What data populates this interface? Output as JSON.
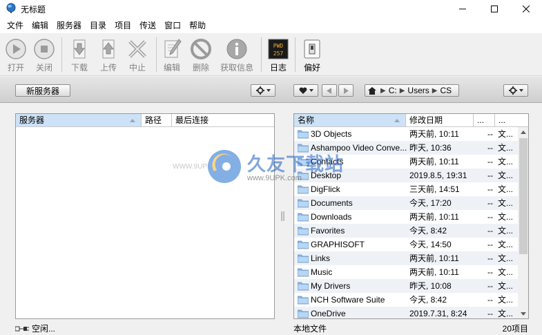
{
  "window": {
    "title": "无标题"
  },
  "menu": [
    "文件",
    "编辑",
    "服务器",
    "目录",
    "项目",
    "传送",
    "窗口",
    "帮助"
  ],
  "toolbar": {
    "open": "打开",
    "close": "关闭",
    "download": "下载",
    "upload": "上传",
    "abort": "中止",
    "edit": "编辑",
    "delete": "删除",
    "get_info": "获取信息",
    "log": "日志",
    "log_icon_text": "PWD\n257",
    "prefs": "偏好"
  },
  "subbar": {
    "new_server": "新服务器",
    "path": [
      "C:",
      "Users",
      "CS"
    ]
  },
  "server_pane": {
    "columns": [
      "服务器",
      "路径",
      "最后连接"
    ]
  },
  "file_pane": {
    "columns": [
      "名称",
      "修改日期",
      "...",
      "..."
    ],
    "rows": [
      {
        "name": "3D Objects",
        "date": "两天前, 10:11",
        "size": "--",
        "type": "文..."
      },
      {
        "name": "Ashampoo Video Conve...",
        "date": "昨天, 10:36",
        "size": "--",
        "type": "文..."
      },
      {
        "name": "Contacts",
        "date": "两天前, 10:11",
        "size": "--",
        "type": "文..."
      },
      {
        "name": "Desktop",
        "date": "2019.8.5, 19:31",
        "size": "--",
        "type": "文..."
      },
      {
        "name": "DigFlick",
        "date": "三天前, 14:51",
        "size": "--",
        "type": "文..."
      },
      {
        "name": "Documents",
        "date": "今天, 17:20",
        "size": "--",
        "type": "文..."
      },
      {
        "name": "Downloads",
        "date": "两天前, 10:11",
        "size": "--",
        "type": "文..."
      },
      {
        "name": "Favorites",
        "date": "今天, 8:42",
        "size": "--",
        "type": "文..."
      },
      {
        "name": "GRAPHISOFT",
        "date": "今天, 14:50",
        "size": "--",
        "type": "文..."
      },
      {
        "name": "Links",
        "date": "两天前, 10:11",
        "size": "--",
        "type": "文..."
      },
      {
        "name": "Music",
        "date": "两天前, 10:11",
        "size": "--",
        "type": "文..."
      },
      {
        "name": "My Drivers",
        "date": "昨天, 10:08",
        "size": "--",
        "type": "文..."
      },
      {
        "name": "NCH Software Suite",
        "date": "今天, 8:42",
        "size": "--",
        "type": "文..."
      },
      {
        "name": "OneDrive",
        "date": "2019.7.31, 8:24",
        "size": "--",
        "type": "文..."
      }
    ]
  },
  "status": {
    "left": "空闲...",
    "middle": "本地文件",
    "right": "20项目"
  },
  "watermark": {
    "brand": "久友下载站",
    "url": "www.9UPK.com",
    "url_left": "WWW.9UPK.COM"
  },
  "colors": {
    "selection": "#cde2f7",
    "folder": "#8ab8e6",
    "accent": "#2060c0"
  }
}
